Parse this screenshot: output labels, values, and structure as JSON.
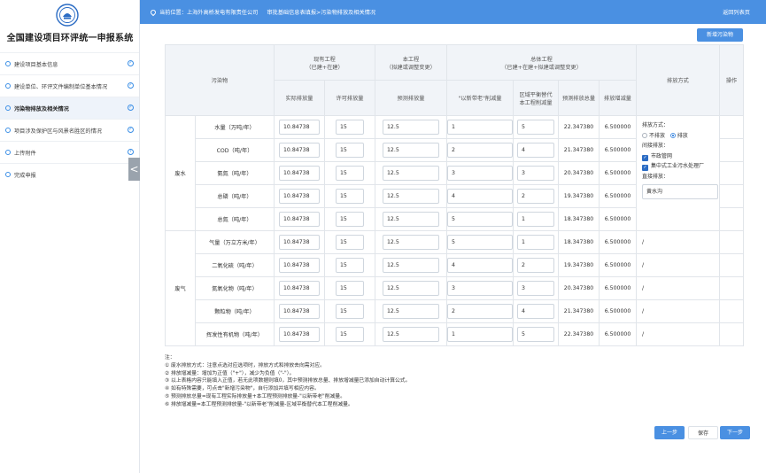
{
  "app": {
    "title": "全国建设项目环评统一申报系统"
  },
  "sidebar": {
    "items": [
      {
        "label": "建设项目基本信息",
        "status": "check"
      },
      {
        "label": "建设单位、环评文件编制单位基本情况",
        "status": "check"
      },
      {
        "label": "污染物排放及相关情况",
        "status": "check",
        "active": true
      },
      {
        "label": "项目涉及保护区与风景名胜区的情况",
        "status": "check"
      },
      {
        "label": "上传附件",
        "status": "question"
      },
      {
        "label": "完成申报",
        "status": ""
      }
    ],
    "collapse_icon": "<"
  },
  "topbar": {
    "location_prefix": "当前位置：",
    "company": "上海外高桥发电有限责任公司",
    "path": "审批基础信息表填报>污染物排放及相关情况",
    "back_label": "返回列表页"
  },
  "add_button": "新增污染物",
  "table": {
    "headers": {
      "pollutant": "污染物",
      "existing": "现有工程",
      "existing_sub": "（已建+在建）",
      "current": "本工程",
      "current_sub": "（拟建或调整变更）",
      "total": "总体工程",
      "total_sub": "（已建+在建+拟建或调整变更）",
      "discharge_method": "排放方式",
      "operation": "操作",
      "actual": "实际排放量",
      "permitted": "许可排放量",
      "predicted": "预测排放量",
      "reduction_old": "\"以新带老\"削减量",
      "regional_sub_1": "区域平衡替代",
      "regional_sub_2": "本工程削减量",
      "predicted_total": "预测排放总量",
      "increase": "排放增减量"
    },
    "groups": [
      {
        "name": "废水",
        "rows": [
          {
            "pollutant": "水量（万吨/年）",
            "actual": "10.84738",
            "permitted": "15",
            "predicted": "12.5",
            "reduction": "1",
            "regional": "5",
            "total": "22.347380",
            "increase": "6.500000"
          },
          {
            "pollutant": "COD（吨/年）",
            "actual": "10.84738",
            "permitted": "15",
            "predicted": "12.5",
            "reduction": "2",
            "regional": "4",
            "total": "21.347380",
            "increase": "6.500000"
          },
          {
            "pollutant": "氨氮（吨/年）",
            "actual": "10.84738",
            "permitted": "15",
            "predicted": "12.5",
            "reduction": "3",
            "regional": "3",
            "total": "20.347380",
            "increase": "6.500000"
          },
          {
            "pollutant": "总磷（吨/年）",
            "actual": "10.84738",
            "permitted": "15",
            "predicted": "12.5",
            "reduction": "4",
            "regional": "2",
            "total": "19.347380",
            "increase": "6.500000"
          },
          {
            "pollutant": "总氮（吨/年）",
            "actual": "10.84738",
            "permitted": "15",
            "predicted": "12.5",
            "reduction": "5",
            "regional": "1",
            "total": "18.347380",
            "increase": "6.500000"
          }
        ],
        "discharge": {
          "label": "排放方式：",
          "option_no": "不排放",
          "option_yes": "排放",
          "indirect_label": "间接排放：",
          "indirect_options": [
            "市政管网",
            "集中式工业污水处理厂"
          ],
          "direct_label": "直接排放：",
          "direct_value": "黄水沟"
        }
      },
      {
        "name": "废气",
        "rows": [
          {
            "pollutant": "气量（万立方米/年）",
            "actual": "10.84738",
            "permitted": "15",
            "predicted": "12.5",
            "reduction": "5",
            "regional": "1",
            "total": "18.347380",
            "increase": "6.500000",
            "discharge": "/"
          },
          {
            "pollutant": "二氧化硫（吨/年）",
            "actual": "10.84738",
            "permitted": "15",
            "predicted": "12.5",
            "reduction": "4",
            "regional": "2",
            "total": "19.347380",
            "increase": "6.500000",
            "discharge": "/"
          },
          {
            "pollutant": "氮氧化物（吨/年）",
            "actual": "10.84738",
            "permitted": "15",
            "predicted": "12.5",
            "reduction": "3",
            "regional": "3",
            "total": "20.347380",
            "increase": "6.500000",
            "discharge": "/"
          },
          {
            "pollutant": "颗粒物（吨/年）",
            "actual": "10.84738",
            "permitted": "15",
            "predicted": "12.5",
            "reduction": "2",
            "regional": "4",
            "total": "21.347380",
            "increase": "6.500000",
            "discharge": "/"
          },
          {
            "pollutant": "挥发性有机物（吨/年）",
            "actual": "10.84738",
            "permitted": "15",
            "predicted": "12.5",
            "reduction": "1",
            "regional": "5",
            "total": "22.347380",
            "increase": "6.500000",
            "discharge": "/"
          }
        ]
      }
    ]
  },
  "notes": [
    "注：",
    "① 废水排放方式：注意点选对应选项时，排放方式和排放去向需对应。",
    "② 排放增减量：增加为正值（\"+\"），减少为负值（\"-\"）。",
    "③ 以上表格内容只能填入正值，若无此项数据则填0，其中预测排放总量、排放增减量已添加自动计算公式。",
    "④ 如有特殊需要，可点击\"新增污染物\"，自行添加并填写相应内容。",
    "⑤ 预测排放总量=现有工程实际排放量+本工程预测排放量-\"以新带老\"削减量。",
    "⑥ 排放增减量=本工程预测排放量-\"以新带老\"削减量-区域平衡替代本工程削减量。"
  ],
  "buttons": {
    "prev": "上一步",
    "save": "保存",
    "next": "下一步"
  },
  "colors": {
    "primary": "#4a90e2",
    "sidebar_active": "#eef3fa",
    "header_bg": "#f1f4f8"
  }
}
